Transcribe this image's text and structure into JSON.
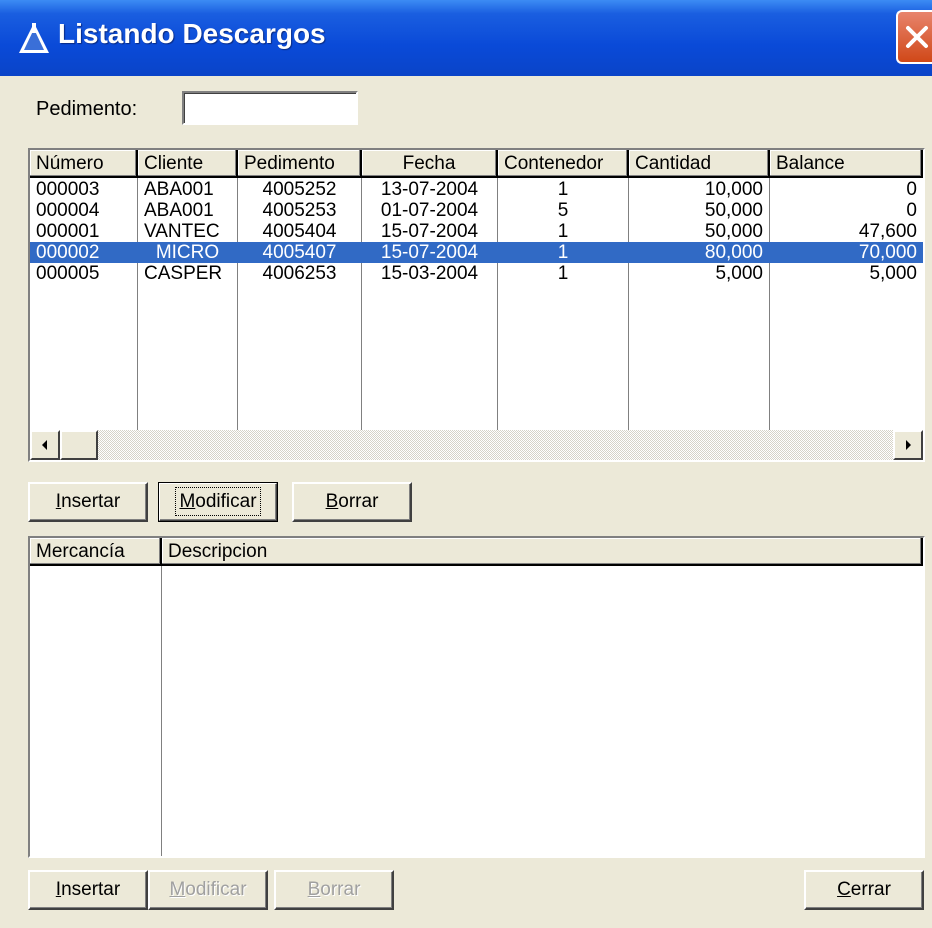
{
  "window": {
    "title": "Listando Descargos",
    "title_icon": "app-icon",
    "close_icon": "close-icon"
  },
  "pedimento": {
    "label": "Pedimento:",
    "value": ""
  },
  "descargos": {
    "columns": [
      "Número",
      "Cliente",
      "Pedimento",
      "Fecha",
      "Contenedor",
      "Cantidad",
      "Balance"
    ],
    "rows": [
      [
        "000003",
        "ABA001",
        "4005252",
        "13-07-2004",
        "1",
        "10,000",
        "0"
      ],
      [
        "000004",
        "ABA001",
        "4005253",
        "01-07-2004",
        "5",
        "50,000",
        "0"
      ],
      [
        "000001",
        "VANTEC",
        "4005404",
        "15-07-2004",
        "1",
        "50,000",
        "47,600"
      ],
      [
        "000002",
        "MICRO",
        "4005407",
        "15-07-2004",
        "1",
        "80,000",
        "70,000"
      ],
      [
        "000005",
        "CASPER",
        "4006253",
        "15-03-2004",
        "1",
        "5,000",
        "5,000"
      ]
    ],
    "selected_index": 3,
    "selection_color": "#316ac5"
  },
  "buttons_top": {
    "insertar": {
      "first": "I",
      "rest": "nsertar"
    },
    "modificar": {
      "first": "M",
      "rest": "odificar"
    },
    "borrar": {
      "first": "B",
      "rest": "orrar"
    }
  },
  "mercancias": {
    "columns": [
      "Mercancía",
      "Descripcion"
    ],
    "rows": []
  },
  "buttons_bottom": {
    "insertar": {
      "first": "I",
      "rest": "nsertar"
    },
    "modificar": {
      "first": "M",
      "rest": "odificar"
    },
    "borrar": {
      "first": "B",
      "rest": "orrar"
    },
    "cerrar": {
      "first": "C",
      "rest": "errar"
    }
  },
  "colors": {
    "titlebar": "#0a4ad8",
    "window_bg": "#ece9d8",
    "close_button": "#d04818"
  }
}
